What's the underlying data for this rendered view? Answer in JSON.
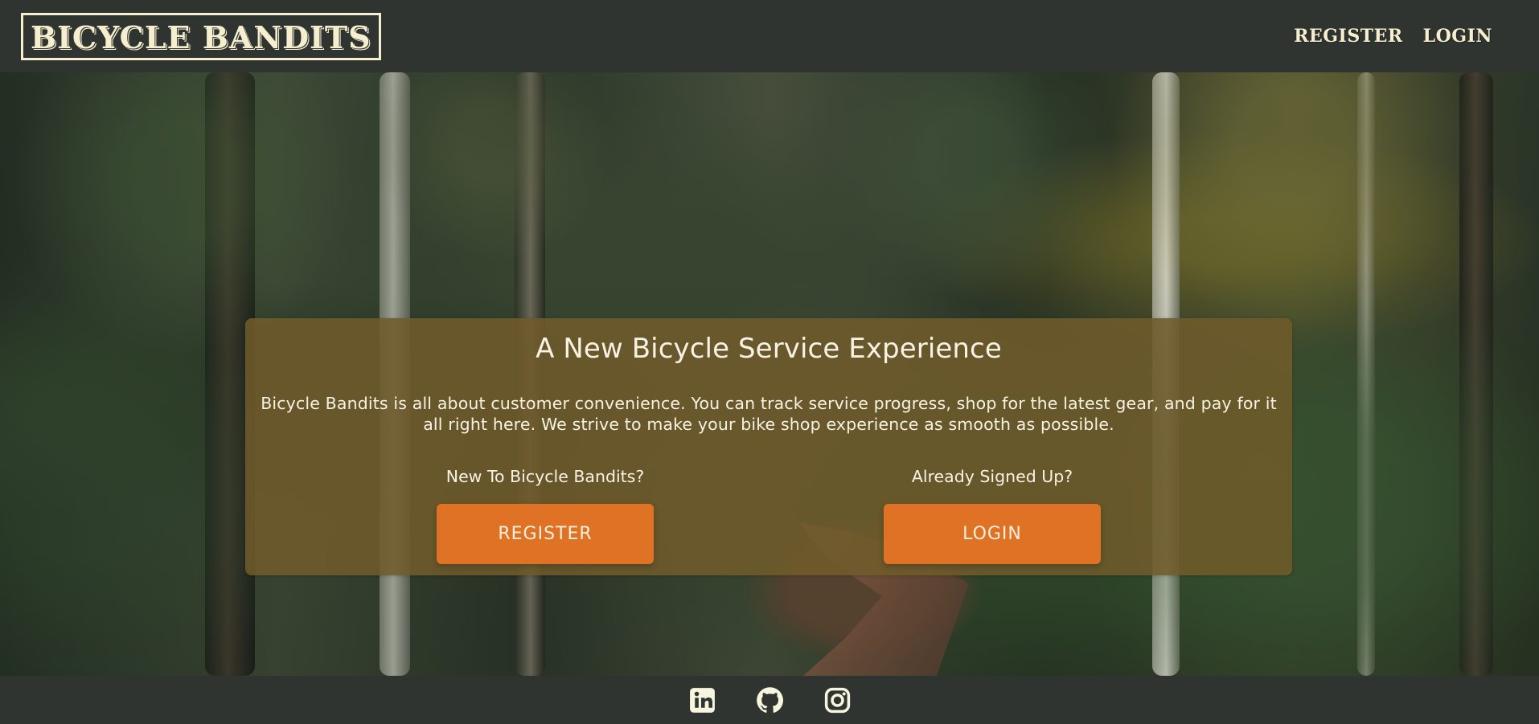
{
  "header": {
    "logo": "BICYCLE BANDITS",
    "nav": {
      "register_label": "REGISTER",
      "login_label": "LOGIN"
    }
  },
  "hero": {
    "title": "A New Bicycle Service Experience",
    "description": "Bicycle Bandits is all about customer convenience. You can track service progress, shop for the latest gear, and pay for it all right here. We strive to make your bike shop experience as smooth as possible.",
    "new_prompt": "New To Bicycle Bandits?",
    "register_button": "REGISTER",
    "existing_prompt": "Already Signed Up?",
    "login_button": "LOGIN"
  },
  "footer": {
    "social_icons": [
      "linkedin-icon",
      "github-icon",
      "instagram-icon"
    ]
  },
  "colors": {
    "header_footer_bg": "#2f3430",
    "text_cream": "#f5efcf",
    "hero_panel": "#6f5b2b",
    "button_orange": "#df7224"
  }
}
